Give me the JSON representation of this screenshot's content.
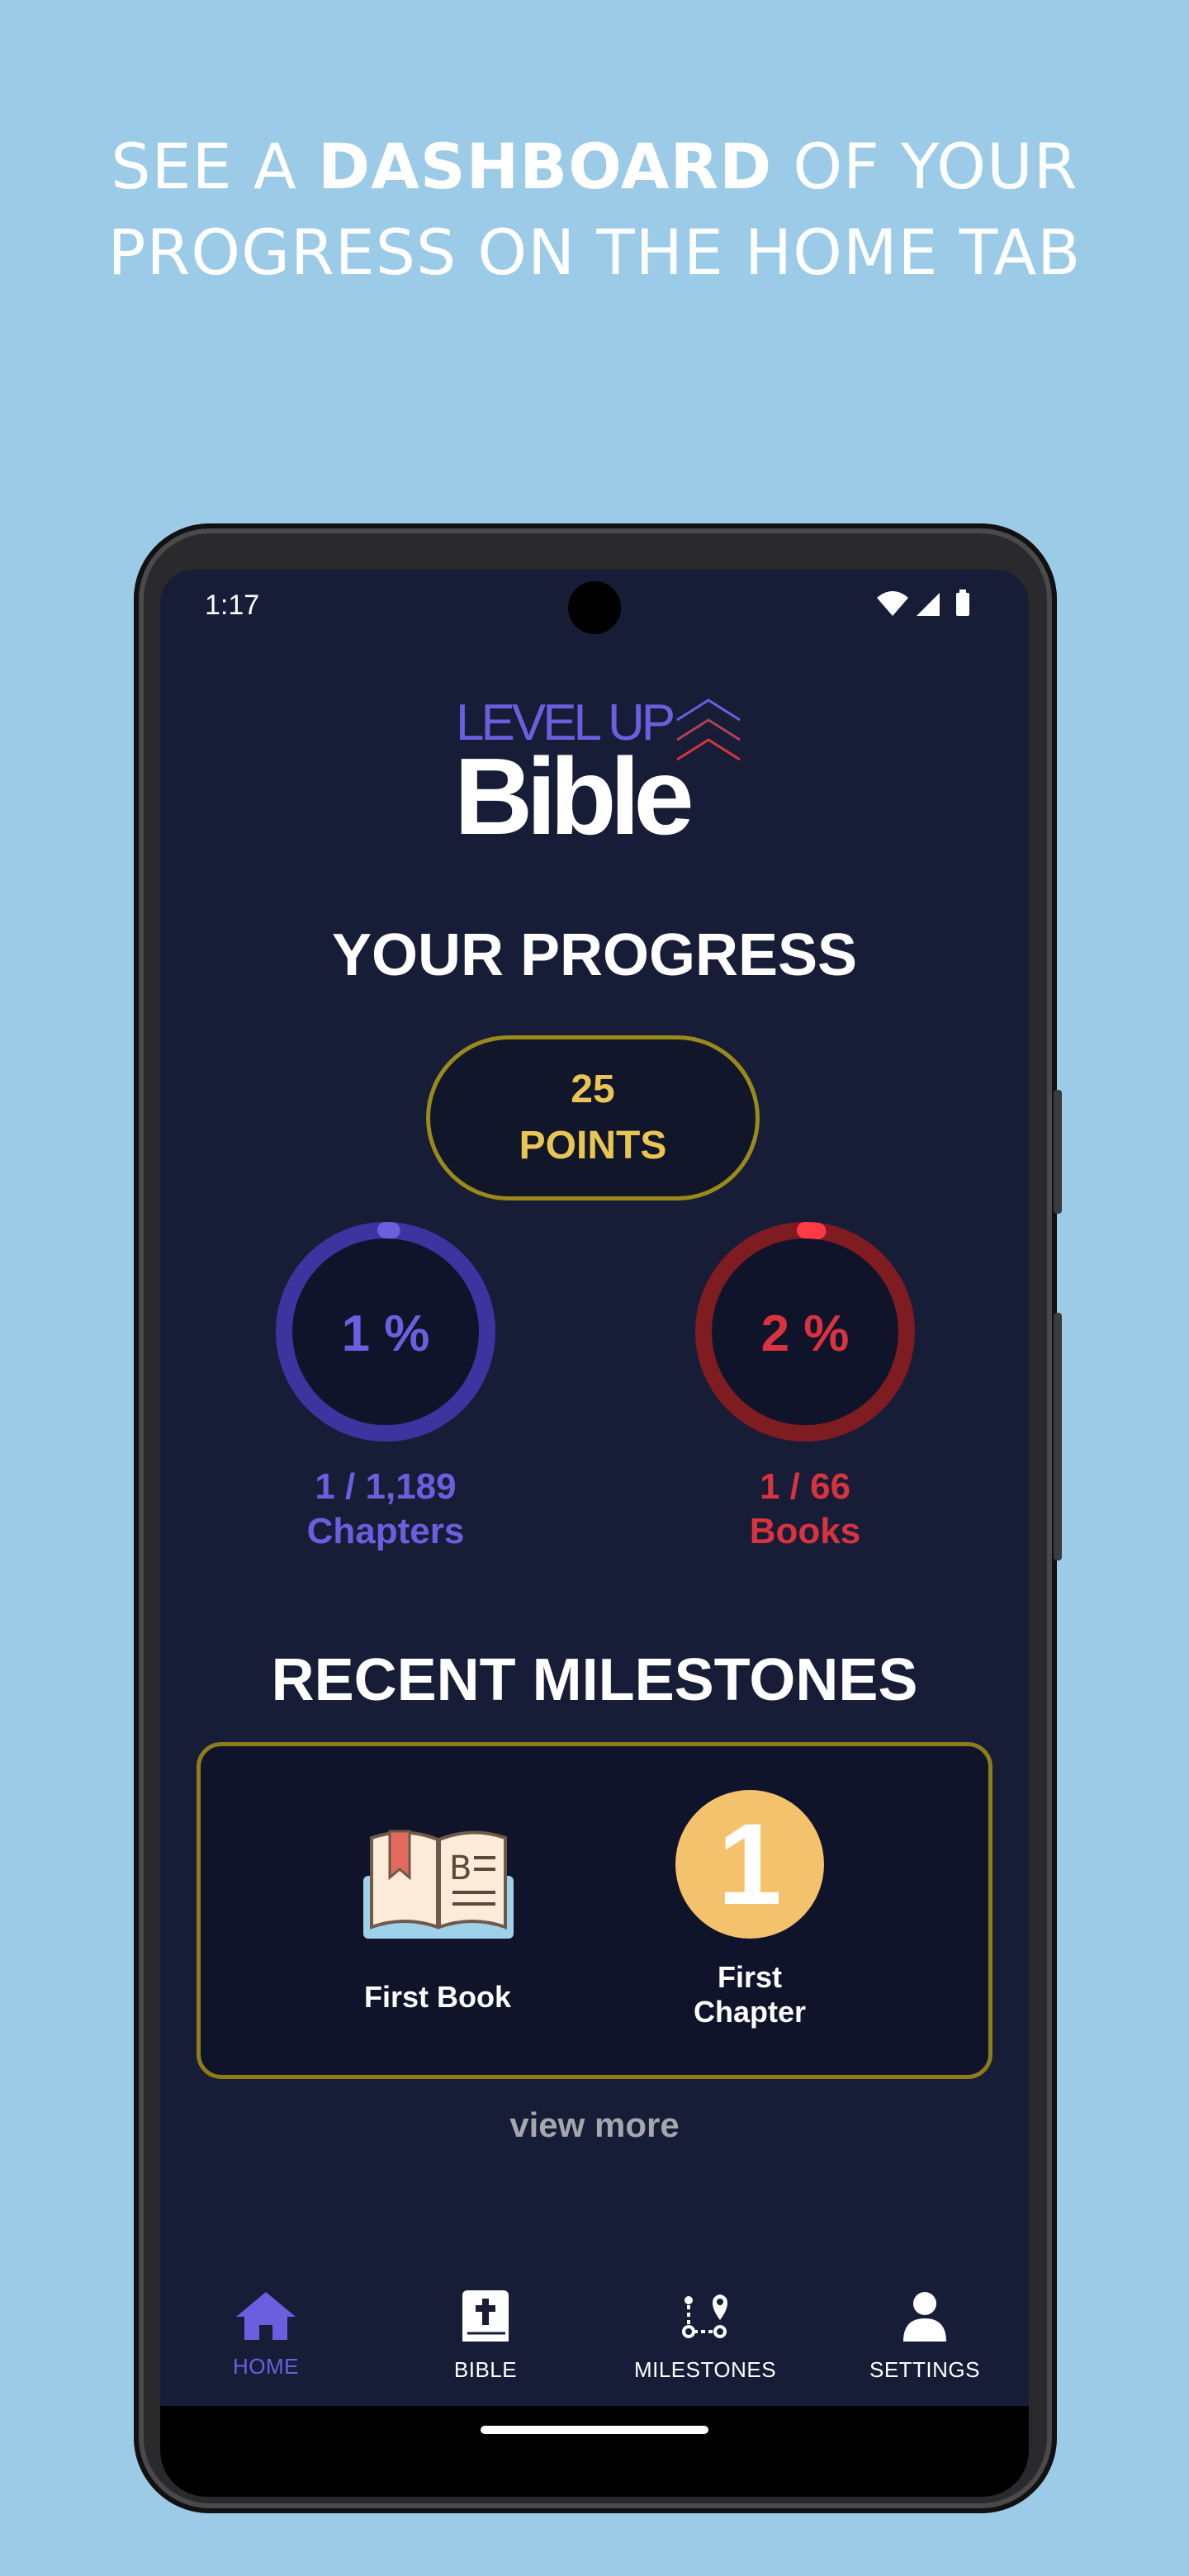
{
  "colors": {
    "background": "#9ccbe8",
    "app_bg": "#171d36",
    "accent_purple": "#6b5fe0",
    "accent_red": "#d8333f",
    "gold": "#e9c653"
  },
  "headline": {
    "prefix": "SEE A ",
    "bold": "DASHBOARD",
    "suffix": " OF YOUR",
    "line2": "PROGRESS ON THE HOME TAB"
  },
  "status_bar": {
    "time": "1:17",
    "icons": [
      "wifi-icon",
      "signal-icon",
      "battery-icon"
    ]
  },
  "logo": {
    "top": "LEVEL UP",
    "bottom": "Bible"
  },
  "progress": {
    "title": "YOUR PROGRESS",
    "points_value": "25",
    "points_label": "POINTS",
    "chapters": {
      "percent_text": "1 %",
      "fraction": 0.01,
      "count": "1 / 1,189",
      "label": "Chapters",
      "color": "#6b5fe0"
    },
    "books": {
      "percent_text": "2 %",
      "fraction": 0.02,
      "count": "1 / 66",
      "label": "Books",
      "color": "#d8333f"
    }
  },
  "milestones": {
    "title": "RECENT MILESTONES",
    "items": [
      {
        "label": "First Book",
        "icon": "open-book-icon"
      },
      {
        "label_line1": "First",
        "label_line2": "Chapter",
        "badge_number": "1",
        "icon": "number-badge-icon"
      }
    ],
    "view_more": "view more"
  },
  "bottom_nav": {
    "items": [
      {
        "label": "HOME",
        "icon": "home-icon",
        "active": true
      },
      {
        "label": "BIBLE",
        "icon": "bible-icon",
        "active": false
      },
      {
        "label": "MILESTONES",
        "icon": "route-icon",
        "active": false
      },
      {
        "label": "SETTINGS",
        "icon": "person-icon",
        "active": false
      }
    ]
  }
}
